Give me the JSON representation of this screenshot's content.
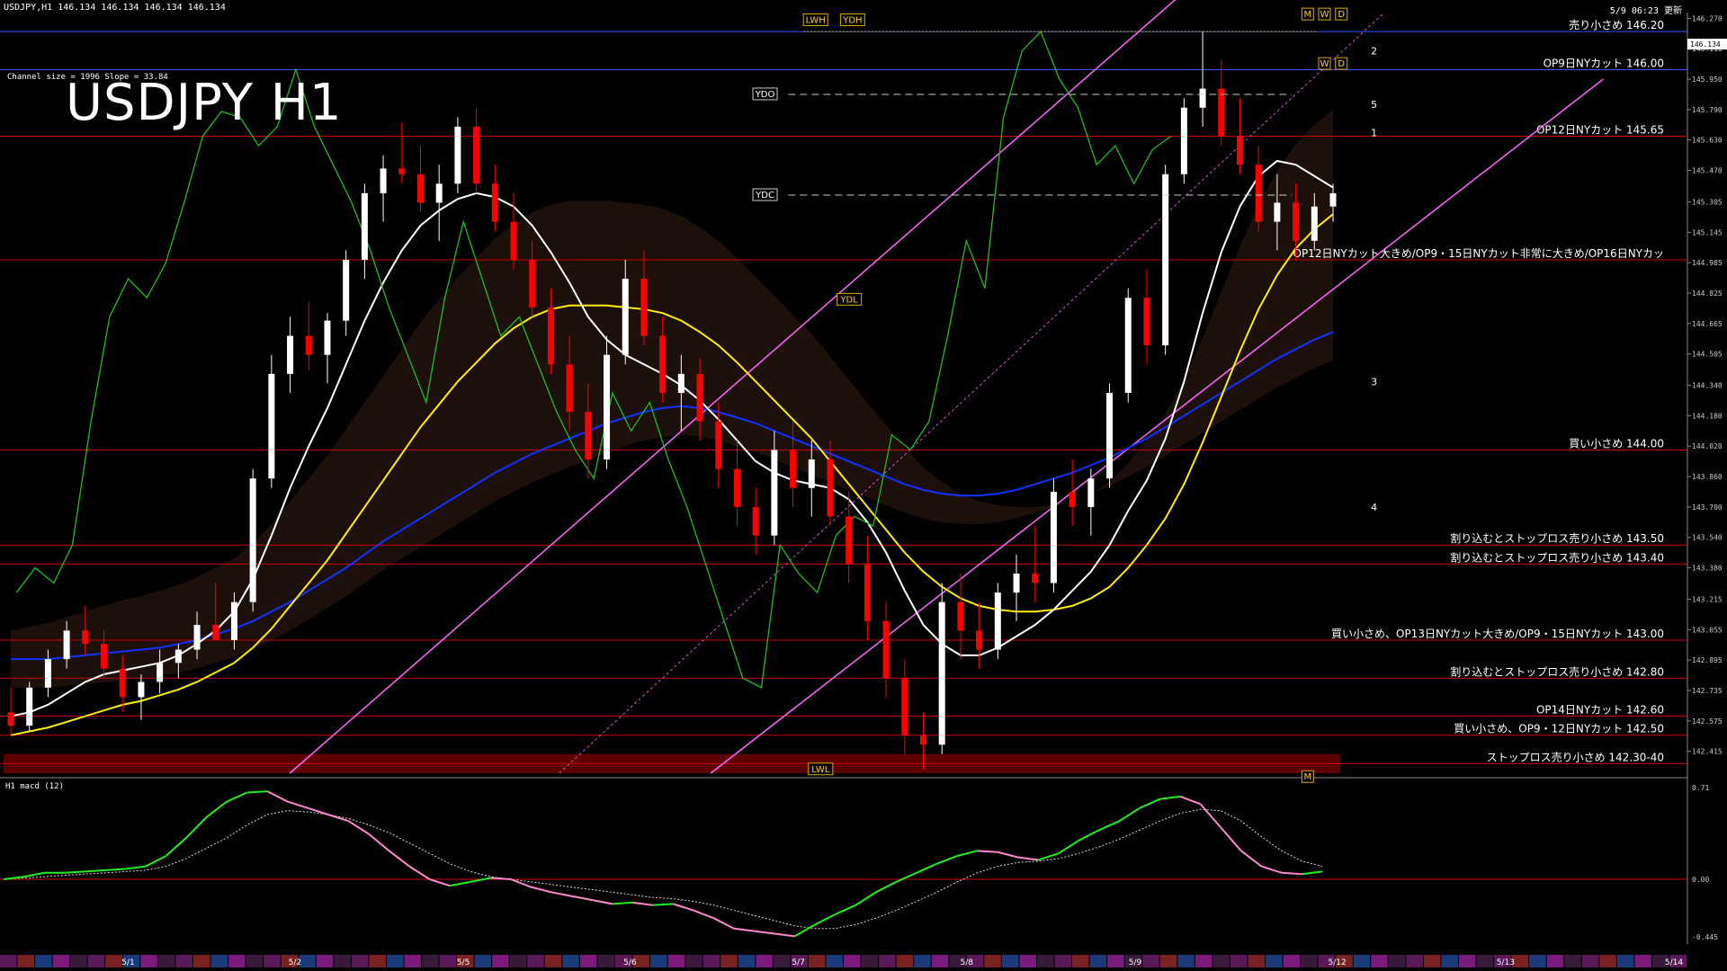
{
  "header": {
    "symbol_info": "USDJPY,H1  146.134 146.134 146.134 146.134",
    "updated": "5/9 06:23 更新",
    "channel_info": "Channel size = 1996 Slope = 33.84",
    "big_title": "USDJPY H1",
    "macd_title": "H1  macd (12)"
  },
  "colors": {
    "background": "#000000",
    "bull": "#ffffff",
    "bear": "#ff0000",
    "level_line": "#cc0000",
    "blue_line": "#3355ff",
    "ma_white": "#ffffff",
    "ma_yellow": "#ffee00",
    "ma_blue": "#1133ff",
    "channel": "#ff66ff",
    "chikou": "#22bb22",
    "macd_main": "#22ee22",
    "macd_down": "#ff88cc"
  },
  "chart_data": {
    "type": "candlestick",
    "title": "USDJPY H1",
    "price_axis": {
      "ylim": [
        142.3,
        146.3
      ],
      "ticks": [
        "146.270",
        "146.110",
        "145.950",
        "145.790",
        "145.630",
        "145.470",
        "145.305",
        "145.145",
        "144.985",
        "144.825",
        "144.665",
        "144.505",
        "144.340",
        "144.180",
        "144.020",
        "143.860",
        "143.700",
        "143.540",
        "143.380",
        "143.215",
        "143.055",
        "142.895",
        "142.735",
        "142.575",
        "142.415"
      ],
      "current_price": "146.134"
    },
    "x_ticks": [
      "5/1",
      "5/2",
      "5/5",
      "5/6",
      "5/7",
      "5/8",
      "5/9",
      "5/12",
      "5/13",
      "5/14"
    ],
    "levels": [
      {
        "price": 146.2,
        "label": "売り小さめ 146.20",
        "color": "#3355ff"
      },
      {
        "price": 146.0,
        "label": "OP9日NYカット 146.00",
        "color": "#3355ff"
      },
      {
        "price": 145.65,
        "label": "OP12日NYカット 145.65",
        "color": "#cc0000"
      },
      {
        "price": 145.0,
        "label": "OP12日NYカット大きめ/OP9・15日NYカット非常に大きめ/OP16日NYカッ",
        "color": "#cc0000"
      },
      {
        "price": 144.0,
        "label": "買い小さめ 144.00",
        "color": "#cc0000"
      },
      {
        "price": 143.5,
        "label": "割り込むとストップロス売り小さめ 143.50",
        "color": "#cc0000"
      },
      {
        "price": 143.4,
        "label": "割り込むとストップロス売り小さめ 143.40",
        "color": "#cc0000"
      },
      {
        "price": 143.0,
        "label": "買い小さめ、OP13日NYカット大きめ/OP9・15日NYカット 143.00",
        "color": "#cc0000"
      },
      {
        "price": 142.8,
        "label": "割り込むとストップロス売り小さめ 142.80",
        "color": "#cc0000"
      },
      {
        "price": 142.6,
        "label": "OP14日NYカット 142.60",
        "color": "#cc0000"
      },
      {
        "price": 142.5,
        "label": "買い小さめ、OP9・12日NYカット 142.50",
        "color": "#cc0000"
      },
      {
        "price": 142.35,
        "label": "ストップロス売り小さめ 142.30-40",
        "color": "#cc0000"
      }
    ],
    "chart_labels": [
      {
        "text": "LWH",
        "price": 146.26,
        "t": 0.475
      },
      {
        "text": "YDH",
        "price": 146.26,
        "t": 0.497
      },
      {
        "text": "YDO",
        "price": 145.87,
        "t": 0.445
      },
      {
        "text": "YDC",
        "price": 145.34,
        "t": 0.445
      },
      {
        "text": "YDL",
        "price": 144.79,
        "t": 0.495
      },
      {
        "text": "LWL",
        "price": 142.32,
        "t": 0.478
      },
      {
        "text": "M",
        "price": 146.29,
        "t": 0.771
      },
      {
        "text": "W",
        "price": 146.29,
        "t": 0.781
      },
      {
        "text": "D",
        "price": 146.29,
        "t": 0.791
      },
      {
        "text": "W",
        "price": 146.03,
        "t": 0.781
      },
      {
        "text": "D",
        "price": 146.03,
        "t": 0.791
      },
      {
        "text": "M",
        "price": 142.28,
        "t": 0.771
      }
    ],
    "wave_labels": [
      "2",
      "5",
      "1",
      "3",
      "4"
    ],
    "macd": {
      "top_label": "0.71",
      "zero_label": "0.00",
      "bottom_label": "-0.445",
      "ylim": [
        -0.5,
        0.75
      ],
      "main": [
        0.0,
        0.02,
        0.05,
        0.05,
        0.06,
        0.07,
        0.08,
        0.1,
        0.18,
        0.32,
        0.48,
        0.6,
        0.67,
        0.68,
        0.6,
        0.55,
        0.5,
        0.45,
        0.35,
        0.22,
        0.1,
        0.0,
        -0.05,
        -0.02,
        0.01,
        0.0,
        -0.06,
        -0.1,
        -0.13,
        -0.16,
        -0.19,
        -0.18,
        -0.2,
        -0.19,
        -0.24,
        -0.3,
        -0.38,
        -0.4,
        -0.42,
        -0.44,
        -0.35,
        -0.27,
        -0.2,
        -0.1,
        -0.02,
        0.05,
        0.12,
        0.18,
        0.22,
        0.21,
        0.17,
        0.15,
        0.2,
        0.3,
        0.38,
        0.45,
        0.55,
        0.62,
        0.64,
        0.58,
        0.4,
        0.22,
        0.1,
        0.05,
        0.04,
        0.06
      ],
      "signal": [
        0.0,
        0.01,
        0.02,
        0.03,
        0.04,
        0.05,
        0.06,
        0.07,
        0.1,
        0.16,
        0.24,
        0.32,
        0.42,
        0.5,
        0.53,
        0.52,
        0.5,
        0.47,
        0.42,
        0.36,
        0.28,
        0.2,
        0.12,
        0.06,
        0.02,
        0.0,
        -0.02,
        -0.04,
        -0.06,
        -0.08,
        -0.1,
        -0.12,
        -0.14,
        -0.15,
        -0.17,
        -0.2,
        -0.24,
        -0.28,
        -0.32,
        -0.36,
        -0.38,
        -0.38,
        -0.35,
        -0.3,
        -0.24,
        -0.17,
        -0.1,
        -0.02,
        0.05,
        0.1,
        0.13,
        0.14,
        0.16,
        0.2,
        0.25,
        0.31,
        0.38,
        0.45,
        0.51,
        0.54,
        0.53,
        0.45,
        0.33,
        0.22,
        0.14,
        0.1
      ]
    },
    "candles": [
      [
        142.62,
        142.75,
        142.5,
        142.55
      ],
      [
        142.55,
        142.78,
        142.52,
        142.75
      ],
      [
        142.75,
        142.95,
        142.7,
        142.9
      ],
      [
        142.9,
        143.1,
        142.85,
        143.05
      ],
      [
        143.05,
        143.18,
        142.92,
        142.98
      ],
      [
        142.98,
        143.05,
        142.8,
        142.85
      ],
      [
        142.85,
        142.92,
        142.62,
        142.7
      ],
      [
        142.7,
        142.82,
        142.58,
        142.78
      ],
      [
        142.78,
        142.95,
        142.72,
        142.88
      ],
      [
        142.88,
        142.98,
        142.8,
        142.95
      ],
      [
        142.95,
        143.15,
        142.9,
        143.08
      ],
      [
        143.08,
        143.3,
        143.02,
        143.0
      ],
      [
        143.0,
        143.25,
        142.95,
        143.2
      ],
      [
        143.2,
        143.9,
        143.15,
        143.85
      ],
      [
        143.85,
        144.5,
        143.8,
        144.4
      ],
      [
        144.4,
        144.7,
        144.3,
        144.6
      ],
      [
        144.6,
        144.78,
        144.42,
        144.5
      ],
      [
        144.5,
        144.72,
        144.35,
        144.68
      ],
      [
        144.68,
        145.05,
        144.6,
        145.0
      ],
      [
        145.0,
        145.4,
        144.9,
        145.35
      ],
      [
        145.35,
        145.55,
        145.2,
        145.48
      ],
      [
        145.48,
        145.72,
        145.4,
        145.45
      ],
      [
        145.45,
        145.6,
        145.25,
        145.3
      ],
      [
        145.3,
        145.5,
        145.1,
        145.4
      ],
      [
        145.4,
        145.75,
        145.35,
        145.7
      ],
      [
        145.7,
        145.8,
        145.35,
        145.4
      ],
      [
        145.4,
        145.5,
        145.15,
        145.2
      ],
      [
        145.2,
        145.35,
        144.95,
        145.0
      ],
      [
        145.0,
        145.1,
        144.7,
        144.75
      ],
      [
        144.75,
        144.85,
        144.4,
        144.45
      ],
      [
        144.45,
        144.6,
        144.1,
        144.2
      ],
      [
        144.2,
        144.35,
        143.85,
        143.95
      ],
      [
        143.95,
        144.6,
        143.9,
        144.5
      ],
      [
        144.5,
        145.0,
        144.45,
        144.9
      ],
      [
        144.9,
        145.05,
        144.55,
        144.6
      ],
      [
        144.6,
        144.7,
        144.25,
        144.3
      ],
      [
        144.3,
        144.5,
        144.1,
        144.4
      ],
      [
        144.4,
        144.48,
        144.05,
        144.15
      ],
      [
        144.15,
        144.25,
        143.8,
        143.9
      ],
      [
        143.9,
        144.05,
        143.6,
        143.7
      ],
      [
        143.7,
        143.8,
        143.45,
        143.55
      ],
      [
        143.55,
        144.1,
        143.5,
        144.0
      ],
      [
        144.0,
        144.15,
        143.7,
        143.8
      ],
      [
        143.8,
        144.05,
        143.65,
        143.95
      ],
      [
        143.95,
        144.05,
        143.6,
        143.65
      ],
      [
        143.65,
        143.78,
        143.3,
        143.4
      ],
      [
        143.4,
        143.55,
        143.0,
        143.1
      ],
      [
        143.1,
        143.2,
        142.7,
        142.8
      ],
      [
        142.8,
        142.9,
        142.4,
        142.5
      ],
      [
        142.5,
        142.62,
        142.32,
        142.45
      ],
      [
        142.45,
        143.3,
        142.4,
        143.2
      ],
      [
        143.2,
        143.35,
        142.9,
        143.05
      ],
      [
        143.05,
        143.2,
        142.85,
        142.95
      ],
      [
        142.95,
        143.3,
        142.9,
        143.25
      ],
      [
        143.25,
        143.45,
        143.1,
        143.35
      ],
      [
        143.35,
        143.6,
        143.2,
        143.3
      ],
      [
        143.3,
        143.85,
        143.25,
        143.78
      ],
      [
        143.78,
        143.95,
        143.6,
        143.7
      ],
      [
        143.7,
        143.9,
        143.55,
        143.85
      ],
      [
        143.85,
        144.35,
        143.8,
        144.3
      ],
      [
        144.3,
        144.85,
        144.25,
        144.8
      ],
      [
        144.8,
        144.95,
        144.45,
        144.55
      ],
      [
        144.55,
        145.5,
        144.5,
        145.45
      ],
      [
        145.45,
        145.85,
        145.4,
        145.8
      ],
      [
        145.8,
        146.2,
        145.7,
        145.9
      ],
      [
        145.9,
        146.05,
        145.6,
        145.65
      ],
      [
        145.65,
        145.85,
        145.45,
        145.5
      ],
      [
        145.5,
        145.6,
        145.15,
        145.2
      ],
      [
        145.2,
        145.45,
        145.05,
        145.3
      ],
      [
        145.3,
        145.4,
        145.0,
        145.1
      ],
      [
        145.1,
        145.35,
        145.05,
        145.28
      ],
      [
        145.28,
        145.4,
        145.2,
        145.35
      ]
    ],
    "ma_white": [
      142.6,
      142.62,
      142.66,
      142.72,
      142.78,
      142.82,
      142.84,
      142.86,
      142.88,
      142.92,
      142.98,
      143.05,
      143.15,
      143.32,
      143.55,
      143.8,
      144.02,
      144.22,
      144.45,
      144.68,
      144.88,
      145.05,
      145.18,
      145.26,
      145.32,
      145.35,
      145.33,
      145.28,
      145.18,
      145.04,
      144.88,
      144.7,
      144.58,
      144.5,
      144.45,
      144.4,
      144.34,
      144.26,
      144.16,
      144.05,
      143.94,
      143.88,
      143.84,
      143.82,
      143.8,
      143.74,
      143.62,
      143.46,
      143.26,
      143.08,
      142.98,
      142.92,
      142.92,
      142.96,
      143.02,
      143.08,
      143.16,
      143.26,
      143.36,
      143.5,
      143.68,
      143.84,
      144.06,
      144.36,
      144.72,
      145.04,
      145.28,
      145.44,
      145.52,
      145.5,
      145.44,
      145.38
    ],
    "ma_yellow": [
      142.5,
      142.52,
      142.54,
      142.57,
      142.6,
      142.63,
      142.66,
      142.68,
      142.71,
      142.74,
      142.78,
      142.83,
      142.88,
      142.96,
      143.06,
      143.18,
      143.3,
      143.42,
      143.56,
      143.7,
      143.84,
      143.98,
      144.12,
      144.24,
      144.36,
      144.46,
      144.56,
      144.64,
      144.7,
      144.74,
      144.76,
      144.76,
      144.76,
      144.75,
      144.74,
      144.72,
      144.68,
      144.62,
      144.55,
      144.46,
      144.36,
      144.26,
      144.16,
      144.06,
      143.94,
      143.82,
      143.7,
      143.58,
      143.46,
      143.36,
      143.28,
      143.22,
      143.18,
      143.16,
      143.15,
      143.15,
      143.16,
      143.18,
      143.22,
      143.28,
      143.38,
      143.5,
      143.64,
      143.82,
      144.04,
      144.28,
      144.52,
      144.74,
      144.92,
      145.06,
      145.16,
      145.24
    ],
    "ma_blue": [
      142.9,
      142.9,
      142.9,
      142.91,
      142.92,
      142.93,
      142.94,
      142.95,
      142.96,
      142.98,
      143.0,
      143.03,
      143.06,
      143.1,
      143.15,
      143.2,
      143.26,
      143.32,
      143.38,
      143.45,
      143.52,
      143.58,
      143.64,
      143.7,
      143.76,
      143.82,
      143.88,
      143.93,
      143.98,
      144.02,
      144.06,
      144.1,
      144.14,
      144.17,
      144.2,
      144.22,
      144.23,
      144.22,
      144.2,
      144.17,
      144.14,
      144.1,
      144.06,
      144.02,
      143.98,
      143.94,
      143.9,
      143.86,
      143.82,
      143.79,
      143.77,
      143.76,
      143.76,
      143.77,
      143.79,
      143.82,
      143.85,
      143.88,
      143.92,
      143.96,
      144.01,
      144.06,
      144.12,
      144.18,
      144.24,
      144.3,
      144.36,
      144.42,
      144.48,
      144.53,
      144.58,
      144.62
    ]
  }
}
